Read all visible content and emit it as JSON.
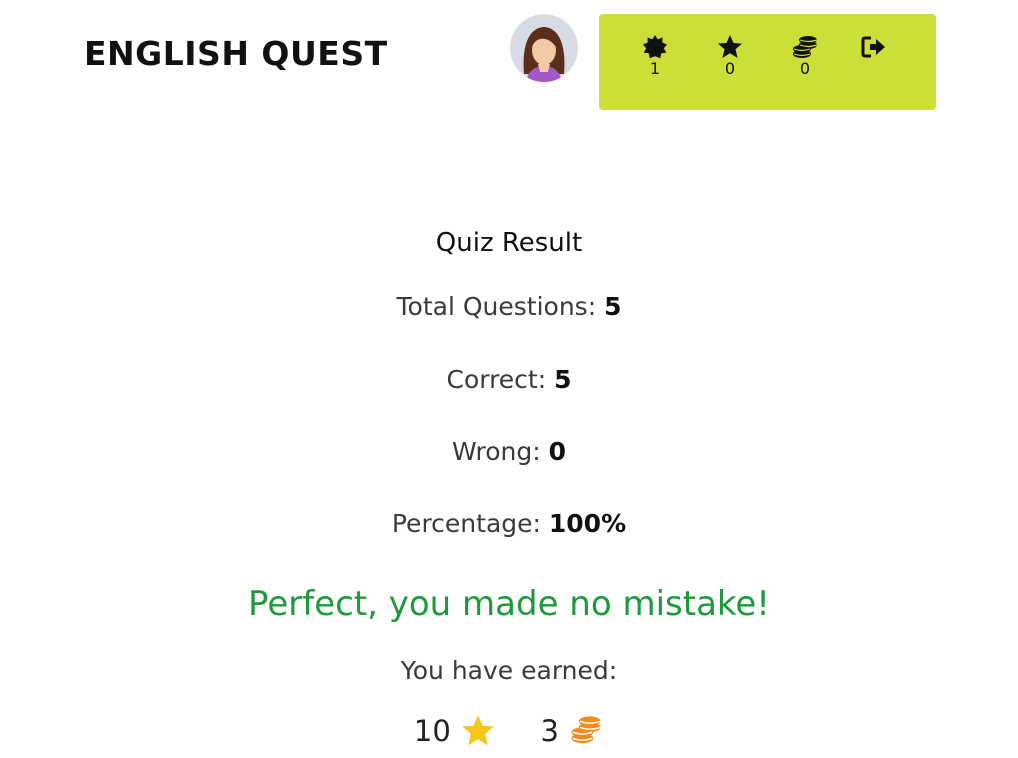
{
  "header": {
    "logo_text": "ENGLISH QUEST"
  },
  "user": {
    "avatar_icon": "woman-avatar-icon"
  },
  "status": {
    "badges_icon": "badge-icon",
    "badges_count": "1",
    "stars_icon": "star-icon",
    "stars_count": "0",
    "coins_icon": "coins-icon",
    "coins_count": "0",
    "logout_icon": "logout-icon",
    "background": "#cede39"
  },
  "result": {
    "title": "Quiz Result",
    "total_label": "Total Questions: ",
    "total_value": "5",
    "correct_label": "Correct: ",
    "correct_value": "5",
    "wrong_label": "Wrong: ",
    "wrong_value": "0",
    "percentage_label": "Percentage: ",
    "percentage_value": "100%",
    "message": "Perfect, you made no mistake!",
    "message_color": "#1d9a3c",
    "earned_label": "You have earned:",
    "earned_stars": "10",
    "earned_coins": "3",
    "star_color": "#f5c518",
    "coin_color": "#f28c1b"
  }
}
